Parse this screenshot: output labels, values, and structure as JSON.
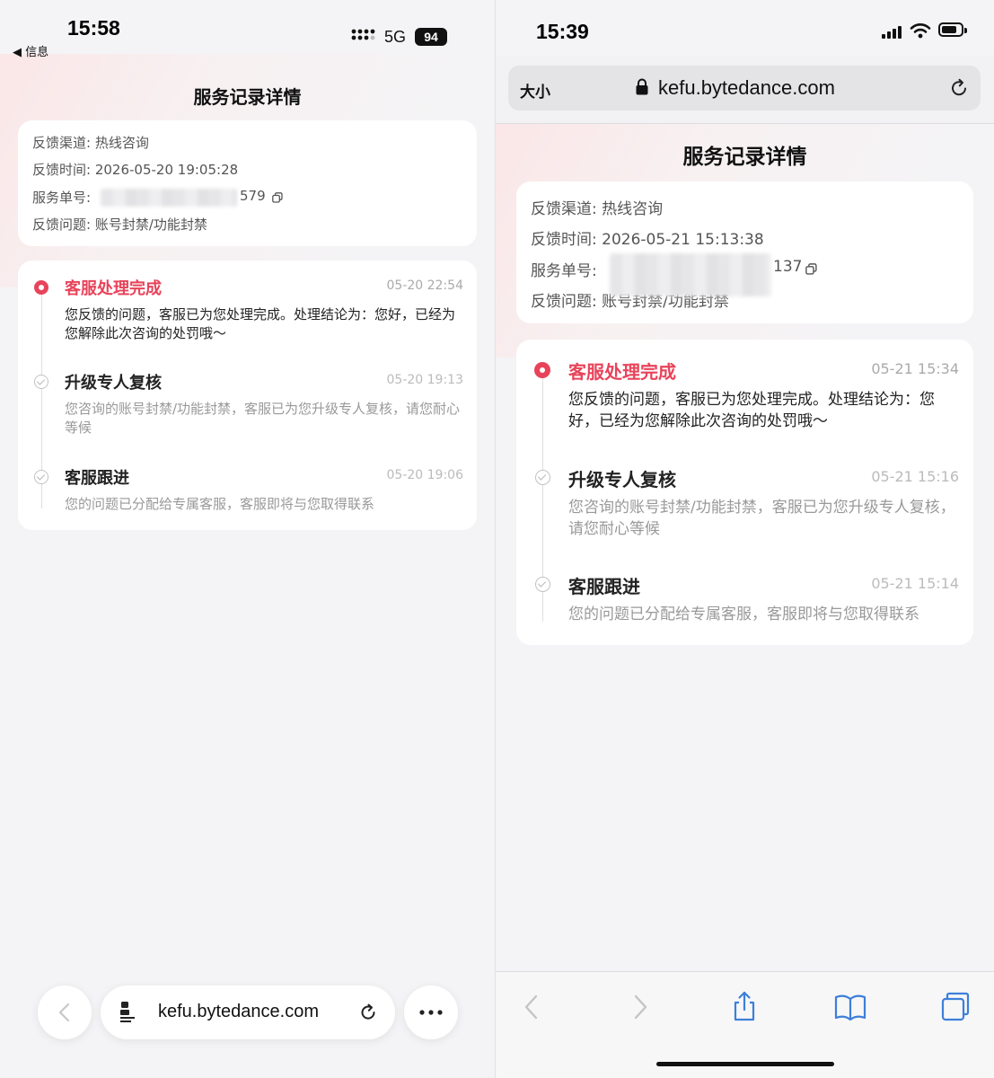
{
  "left": {
    "status": {
      "time": "15:58",
      "back_label": "◀ 信息",
      "network": "5G",
      "battery": "94"
    },
    "page_title": "服务记录详情",
    "info": {
      "channel_label": "反馈渠道:",
      "channel_value": "热线咨询",
      "time_label": "反馈时间:",
      "time_value": "2026-05-20 19:05:28",
      "ticket_label": "服务单号:",
      "ticket_suffix": "579",
      "issue_label": "反馈问题:",
      "issue_value": "账号封禁/功能封禁"
    },
    "timeline": [
      {
        "title": "客服处理完成",
        "time": "05-20 22:54",
        "desc": "您反馈的问题，客服已为您处理完成。处理结论为：您好，已经为您解除此次咨询的处罚哦～"
      },
      {
        "title": "升级专人复核",
        "time": "05-20 19:13",
        "desc": "您咨询的账号封禁/功能封禁，客服已为您升级专人复核，请您耐心等候"
      },
      {
        "title": "客服跟进",
        "time": "05-20 19:06",
        "desc": "您的问题已分配给专属客服，客服即将与您取得联系"
      }
    ],
    "toolbar": {
      "back_icon": "chevron-left-icon",
      "url": "kefu.bytedance.com",
      "reload_icon": "reload-icon",
      "more_icon": "more-icon"
    }
  },
  "right": {
    "status": {
      "time": "15:39"
    },
    "address_bar": {
      "text_size": "大小",
      "url": "kefu.bytedance.com"
    },
    "page_title": "服务记录详情",
    "info": {
      "channel_label": "反馈渠道:",
      "channel_value": "热线咨询",
      "time_label": "反馈时间:",
      "time_value": "2026-05-21 15:13:38",
      "ticket_label": "服务单号:",
      "ticket_suffix": "137",
      "issue_label": "反馈问题:",
      "issue_value": "账号封禁/功能封禁"
    },
    "timeline": [
      {
        "title": "客服处理完成",
        "time": "05-21 15:34",
        "desc": "您反馈的问题，客服已为您处理完成。处理结论为：您好，已经为您解除此次咨询的处罚哦～"
      },
      {
        "title": "升级专人复核",
        "time": "05-21 15:16",
        "desc": "您咨询的账号封禁/功能封禁，客服已为您升级专人复核，请您耐心等候"
      },
      {
        "title": "客服跟进",
        "time": "05-21 15:14",
        "desc": "您的问题已分配给专属客服，客服即将与您取得联系"
      }
    ]
  },
  "colors": {
    "accent": "#e8435a",
    "muted": "#999999",
    "background": "#f4f4f6"
  }
}
